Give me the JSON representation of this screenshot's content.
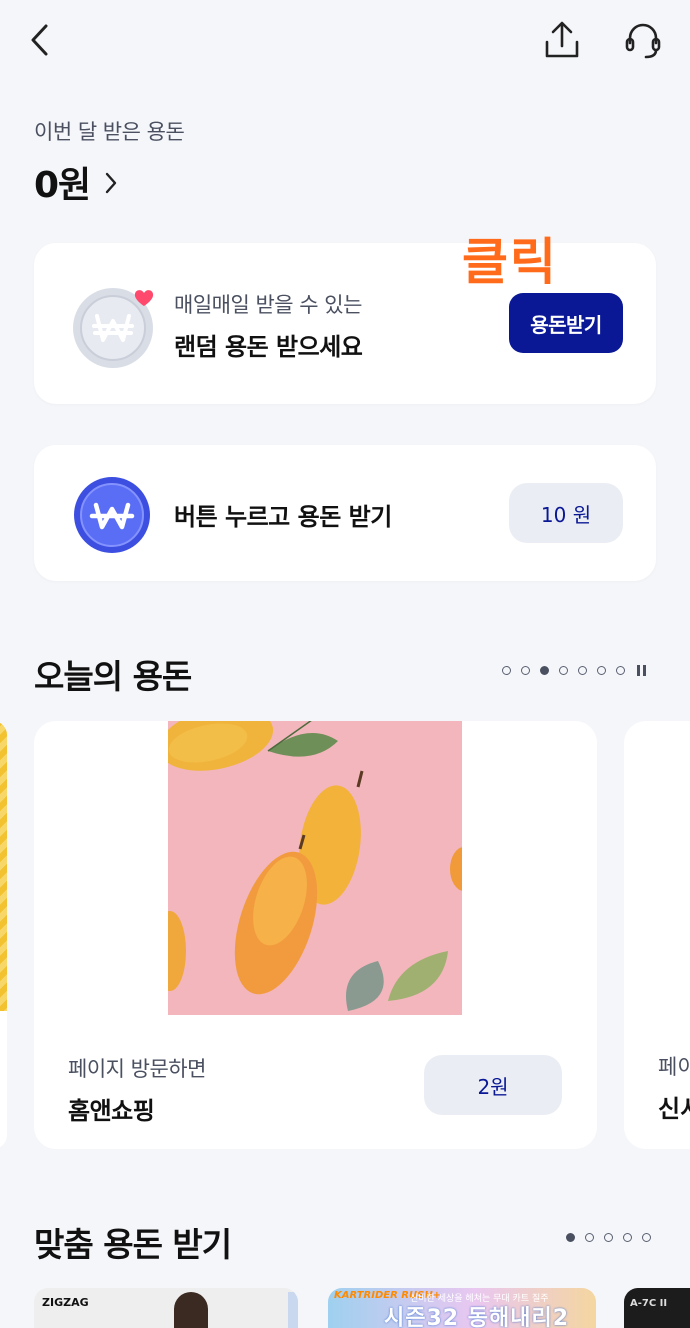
{
  "header": {
    "back_icon": "chevron-left-icon",
    "share_icon": "share-upload-icon",
    "support_icon": "headset-icon"
  },
  "summary": {
    "label": "이번 달 받은 용돈",
    "amount": "0원"
  },
  "annotation": {
    "click_label": "클릭"
  },
  "random_card": {
    "subtitle": "매일매일 받을 수 있는",
    "title": "랜덤 용돈 받으세요",
    "button_label": "용돈받기"
  },
  "button_card": {
    "title": "버튼 누르고 용돈 받기",
    "amount": "10 원"
  },
  "today": {
    "title": "오늘의 용돈",
    "dot_count": 7,
    "active_dot": 3,
    "slide": {
      "subtitle": "페이지 방문하면",
      "title": "홈앤쇼핑",
      "amount": "2원"
    },
    "next_slide": {
      "subtitle": "페이",
      "title": "신서"
    }
  },
  "fit": {
    "title": "맞춤 용돈 받기",
    "dot_count": 5,
    "active_dot": 1,
    "thumbs": {
      "t1_brand": "ZIGZAG",
      "t2_logo": "KARTRIDER RUSH+",
      "t2_note": "신비한 세상을 헤쳐는 무대 카트 질주",
      "t2_headline": "시즌32 동해내리2",
      "t3_tag": "A-7C II"
    }
  },
  "colors": {
    "accent": "#0a1896",
    "click_label": "#ff6b1a",
    "background": "#f5f6fa"
  }
}
